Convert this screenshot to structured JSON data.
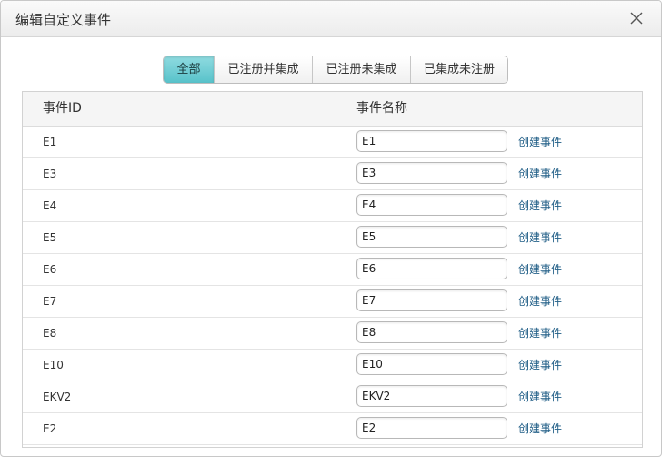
{
  "dialog": {
    "title": "编辑自定义事件"
  },
  "tabs": [
    {
      "label": "全部",
      "active": true
    },
    {
      "label": "已注册并集成",
      "active": false
    },
    {
      "label": "已注册未集成",
      "active": false
    },
    {
      "label": "已集成未注册",
      "active": false
    }
  ],
  "table": {
    "headers": [
      "事件ID",
      "事件名称"
    ],
    "action_label": "创建事件",
    "rows": [
      {
        "id": "E1",
        "name": "E1"
      },
      {
        "id": "E3",
        "name": "E3"
      },
      {
        "id": "E4",
        "name": "E4"
      },
      {
        "id": "E5",
        "name": "E5"
      },
      {
        "id": "E6",
        "name": "E6"
      },
      {
        "id": "E7",
        "name": "E7"
      },
      {
        "id": "E8",
        "name": "E8"
      },
      {
        "id": "E10",
        "name": "E10"
      },
      {
        "id": "EKV2",
        "name": "EKV2"
      },
      {
        "id": "E2",
        "name": "E2"
      }
    ]
  },
  "colors": {
    "active_tab": "#58c2ca",
    "link": "#1f5d86"
  },
  "icons": {
    "close": "close-icon"
  }
}
